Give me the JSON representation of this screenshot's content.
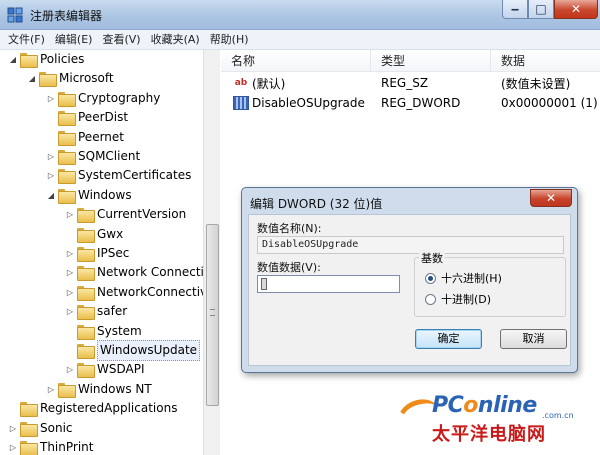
{
  "window": {
    "title": "注册表编辑器",
    "close_glyph": "✕",
    "max_glyph": "□",
    "min_glyph": "‒"
  },
  "menu": [
    "文件(F)",
    "编辑(E)",
    "查看(V)",
    "收藏夹(A)",
    "帮助(H)"
  ],
  "tree": [
    {
      "label": "Policies",
      "level": 1,
      "state": "expanded"
    },
    {
      "label": "Microsoft",
      "level": 2,
      "state": "expanded"
    },
    {
      "label": "Cryptography",
      "level": 3,
      "state": "collapsed"
    },
    {
      "label": "PeerDist",
      "level": 3,
      "state": "none"
    },
    {
      "label": "Peernet",
      "level": 3,
      "state": "none"
    },
    {
      "label": "SQMClient",
      "level": 3,
      "state": "collapsed"
    },
    {
      "label": "SystemCertificates",
      "level": 3,
      "state": "collapsed"
    },
    {
      "label": "Windows",
      "level": 3,
      "state": "expanded"
    },
    {
      "label": "CurrentVersion",
      "level": 4,
      "state": "collapsed"
    },
    {
      "label": "Gwx",
      "level": 4,
      "state": "none"
    },
    {
      "label": "IPSec",
      "level": 4,
      "state": "collapsed"
    },
    {
      "label": "Network Connecti",
      "level": 4,
      "state": "collapsed"
    },
    {
      "label": "NetworkConnectiv",
      "level": 4,
      "state": "collapsed"
    },
    {
      "label": "safer",
      "level": 4,
      "state": "collapsed"
    },
    {
      "label": "System",
      "level": 4,
      "state": "none"
    },
    {
      "label": "WindowsUpdate",
      "level": 4,
      "state": "none",
      "selected": true
    },
    {
      "label": "WSDAPI",
      "level": 4,
      "state": "collapsed"
    },
    {
      "label": "Windows NT",
      "level": 3,
      "state": "collapsed"
    },
    {
      "label": "RegisteredApplications",
      "level": 1,
      "state": "none"
    },
    {
      "label": "Sonic",
      "level": 1,
      "state": "collapsed"
    },
    {
      "label": "ThinPrint",
      "level": 1,
      "state": "collapsed"
    }
  ],
  "list": {
    "headers": [
      "名称",
      "类型",
      "数据"
    ],
    "rows": [
      {
        "icon": "string-value-icon",
        "icon_text": "ab",
        "name": "(默认)",
        "type": "REG_SZ",
        "data": "(数值未设置)"
      },
      {
        "icon": "dword-value-icon",
        "icon_text": "",
        "name": "DisableOSUpgrade",
        "type": "REG_DWORD",
        "data": "0x00000001 (1)"
      }
    ]
  },
  "dialog": {
    "title": "编辑 DWORD (32 位)值",
    "close_glyph": "✕",
    "value_name_label": "数值名称(N):",
    "value_name": "DisableOSUpgrade",
    "value_data_label": "数值数据(V):",
    "value_data": "",
    "base_label": "基数",
    "base_options": [
      {
        "label": "十六进制(H)",
        "selected": true
      },
      {
        "label": "十进制(D)",
        "selected": false
      }
    ],
    "ok_label": "确定",
    "cancel_label": "取消"
  },
  "watermark": {
    "logo_pre": "PC",
    "logo_o": "o",
    "logo_post": "nline",
    "domain": ".com.cn",
    "cn": "太平洋电脑网"
  },
  "colors": {
    "titlebar": "#aac4e2",
    "close_button": "#c7432a",
    "selection": "#e9f0fb",
    "watermark_blue": "#2a62b4",
    "watermark_red": "#c91a1a",
    "watermark_orange": "#f08a1a"
  }
}
